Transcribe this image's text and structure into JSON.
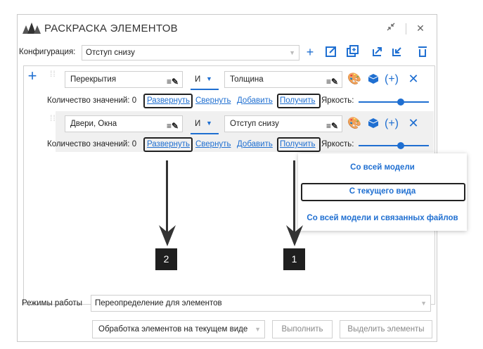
{
  "window": {
    "title": "РАСКРАСКА ЭЛЕМЕНТОВ",
    "minimize_icon": "shrink-arrows-icon",
    "close_glyph": "✕"
  },
  "config": {
    "label": "Конфигурация:",
    "value": "Отступ снизу"
  },
  "rules": [
    {
      "category": "Перекрытия",
      "operator": "И",
      "parameter": "Толщина",
      "count_label": "Количество значений: 0",
      "expand": "Развернуть",
      "collapse": "Свернуть",
      "add": "Добавить",
      "get": "Получить",
      "brightness": "Яркость:",
      "brightness_level": 0.8
    },
    {
      "category": "Двери, Окна",
      "operator": "И",
      "parameter": "Отступ снизу",
      "count_label": "Количество значений: 0",
      "expand": "Развернуть",
      "collapse": "Свернуть",
      "add": "Добавить",
      "get": "Получить",
      "brightness": "Яркость:",
      "brightness_level": 0.8
    }
  ],
  "popup": {
    "items": [
      "Со всей модели",
      "С текущего вида",
      "Со всей модели и связанных файлов"
    ]
  },
  "callouts": {
    "left": "2",
    "right": "1"
  },
  "modes": {
    "label": "Режимы работы",
    "value": "Переопределение для элементов"
  },
  "footer": {
    "scope": "Обработка элементов на текущем виде",
    "run": "Выполнить",
    "select": "Выделить элементы"
  },
  "colors": {
    "accent": "#1f6fd1"
  }
}
